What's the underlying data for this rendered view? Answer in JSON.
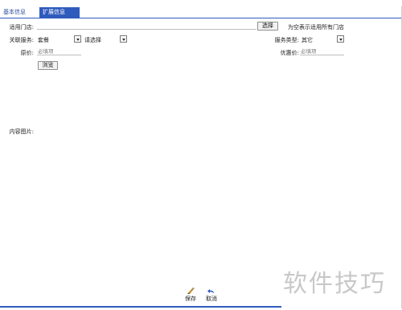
{
  "tabs": {
    "basic": "基本信息",
    "extended": "扩展信息"
  },
  "form": {
    "store_label": "适用门店:",
    "store_value": "",
    "select_button": "选择",
    "store_hint": "为空表示适用所有门店",
    "related_service_label": "关联服务:",
    "related_service_value": "套餐",
    "related_service_sub_value": "请选择",
    "service_type_label": "服务类型:",
    "service_type_value": "其它",
    "original_price_label": "原价:",
    "original_price_placeholder": "必填项",
    "discount_price_label": "优惠价:",
    "discount_price_placeholder": "必填项",
    "browse_button": "浏览",
    "content_image_label": "内容图片:"
  },
  "actions": {
    "save": "保存",
    "cancel": "取消"
  },
  "watermark": "软件技巧",
  "colors": {
    "accent": "#2f5bbd",
    "link": "#2a4fa0"
  }
}
